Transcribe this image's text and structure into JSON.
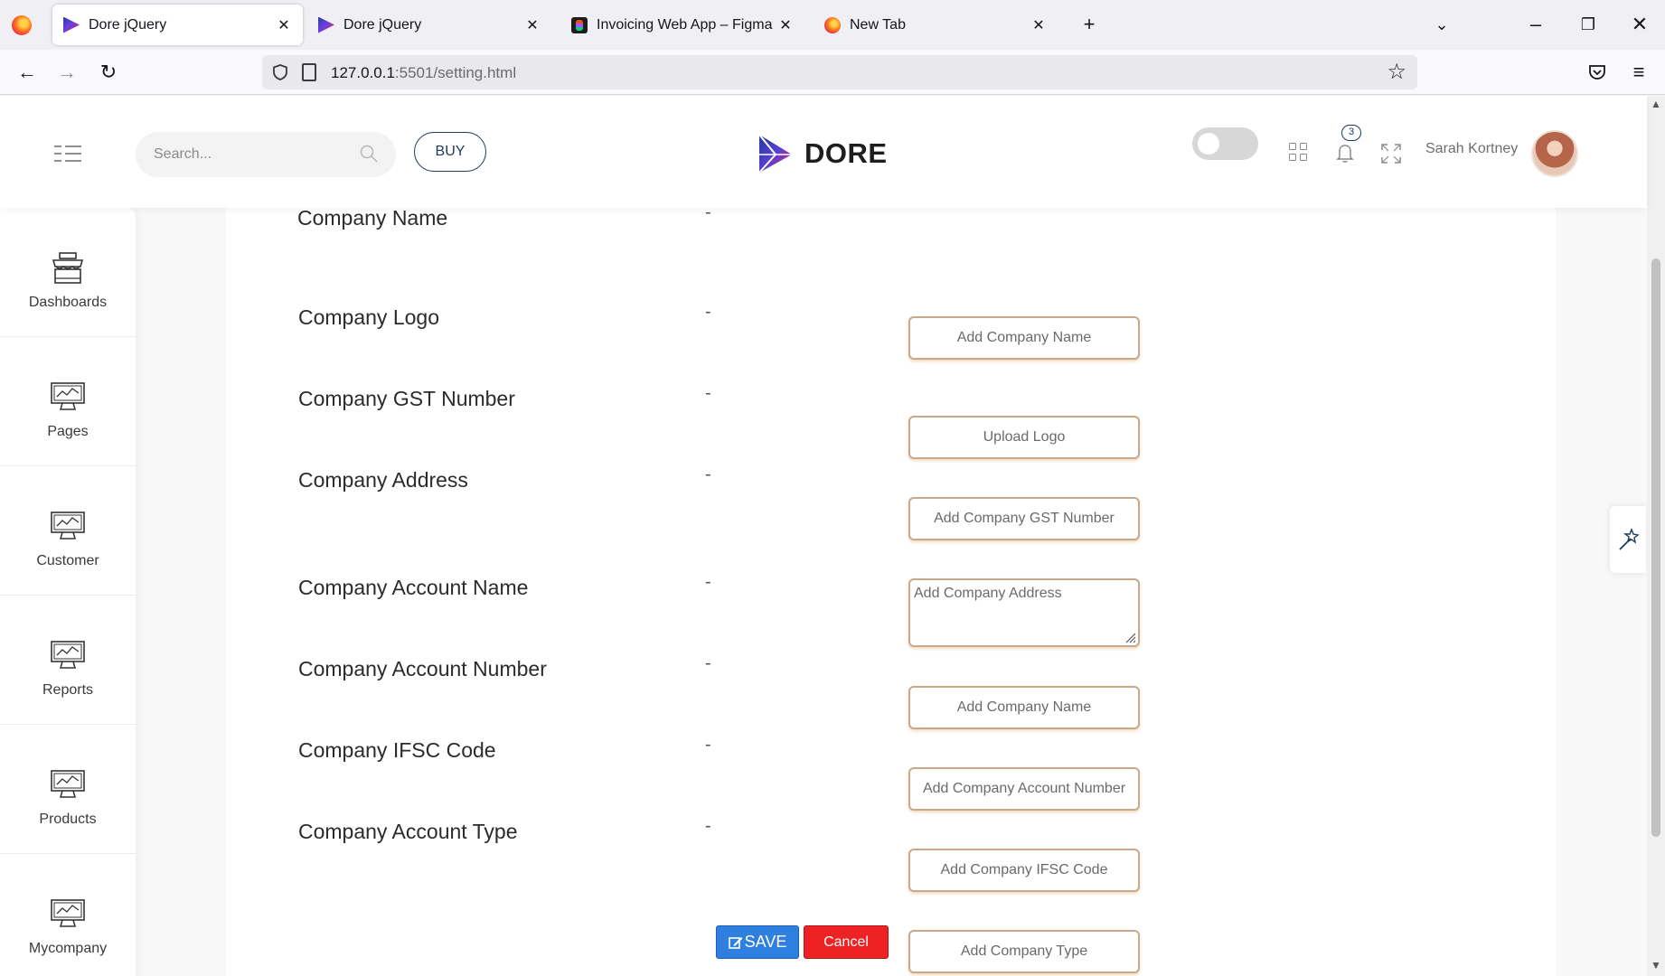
{
  "browser": {
    "tabs": [
      {
        "title": "Dore jQuery",
        "favicon": "dore-favicon",
        "active": true
      },
      {
        "title": "Dore jQuery",
        "favicon": "dore-favicon",
        "active": false
      },
      {
        "title": "Invoicing Web App – Figma",
        "favicon": "figma-favicon",
        "active": false
      },
      {
        "title": "New Tab",
        "favicon": "firefox-favicon",
        "active": false
      }
    ],
    "url_host": "127.0.0.1",
    "url_rest": ":5501/setting.html"
  },
  "header": {
    "search_placeholder": "Search...",
    "buy_label": "BUY",
    "brand": "DORE",
    "notification_count": "3",
    "user_name": "Sarah Kortney"
  },
  "sidebar": {
    "items": [
      {
        "label": "Dashboards",
        "icon": "shop-icon"
      },
      {
        "label": "Pages",
        "icon": "monitor-icon"
      },
      {
        "label": "Customer",
        "icon": "monitor-icon"
      },
      {
        "label": "Reports",
        "icon": "monitor-icon"
      },
      {
        "label": "Products",
        "icon": "monitor-icon"
      },
      {
        "label": "Mycompany",
        "icon": "monitor-icon"
      }
    ]
  },
  "form": {
    "separator": "-",
    "rows": [
      {
        "label": "Company Name",
        "placeholder": "Add Company Name",
        "type": "input"
      },
      {
        "label": "Company Logo",
        "placeholder": "Upload Logo",
        "type": "upload"
      },
      {
        "label": "Company GST Number",
        "placeholder": "Add Company GST Number",
        "type": "input"
      },
      {
        "label": "Company Address",
        "placeholder": "Add Company Address",
        "type": "textarea"
      },
      {
        "label": "Company Account Name",
        "placeholder": "Add Company Name",
        "type": "input"
      },
      {
        "label": "Company Account Number",
        "placeholder": "Add Company Account Number",
        "type": "input"
      },
      {
        "label": "Company IFSC Code",
        "placeholder": "Add Company IFSC Code",
        "type": "input"
      },
      {
        "label": "Company Account Type",
        "placeholder": "Add Company Type",
        "type": "input"
      }
    ],
    "save_label": "SAVE",
    "cancel_label": "Cancel"
  },
  "colors": {
    "accent": "#1b3a5c",
    "save": "#2f7fe0",
    "cancel": "#ee2222",
    "field_border": "#c9a98a"
  }
}
